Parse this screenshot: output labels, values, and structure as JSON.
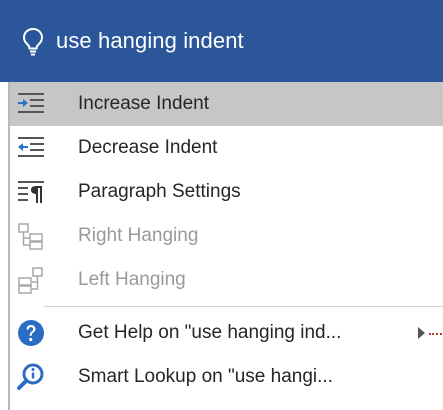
{
  "search": {
    "query": "use hanging indent",
    "icon": "lightbulb-icon",
    "bar_color": "#2b579a"
  },
  "menu": {
    "items": [
      {
        "label": "Increase Indent",
        "icon": "increase-indent-icon",
        "state": "highlighted"
      },
      {
        "label": "Decrease Indent",
        "icon": "decrease-indent-icon",
        "state": "enabled"
      },
      {
        "label": "Paragraph Settings",
        "icon": "paragraph-settings-icon",
        "state": "enabled"
      },
      {
        "label": "Right Hanging",
        "icon": "right-hanging-icon",
        "state": "disabled"
      },
      {
        "label": "Left Hanging",
        "icon": "left-hanging-icon",
        "state": "disabled"
      },
      {
        "label": "Get Help on \"use hanging ind...",
        "icon": "help-icon",
        "state": "enabled",
        "has_submenu": true
      },
      {
        "label": "Smart Lookup on \"use hangi...",
        "icon": "smart-lookup-icon",
        "state": "enabled"
      }
    ],
    "highlight_color": "#c6c6c6",
    "accent_color": "#2b579a"
  }
}
